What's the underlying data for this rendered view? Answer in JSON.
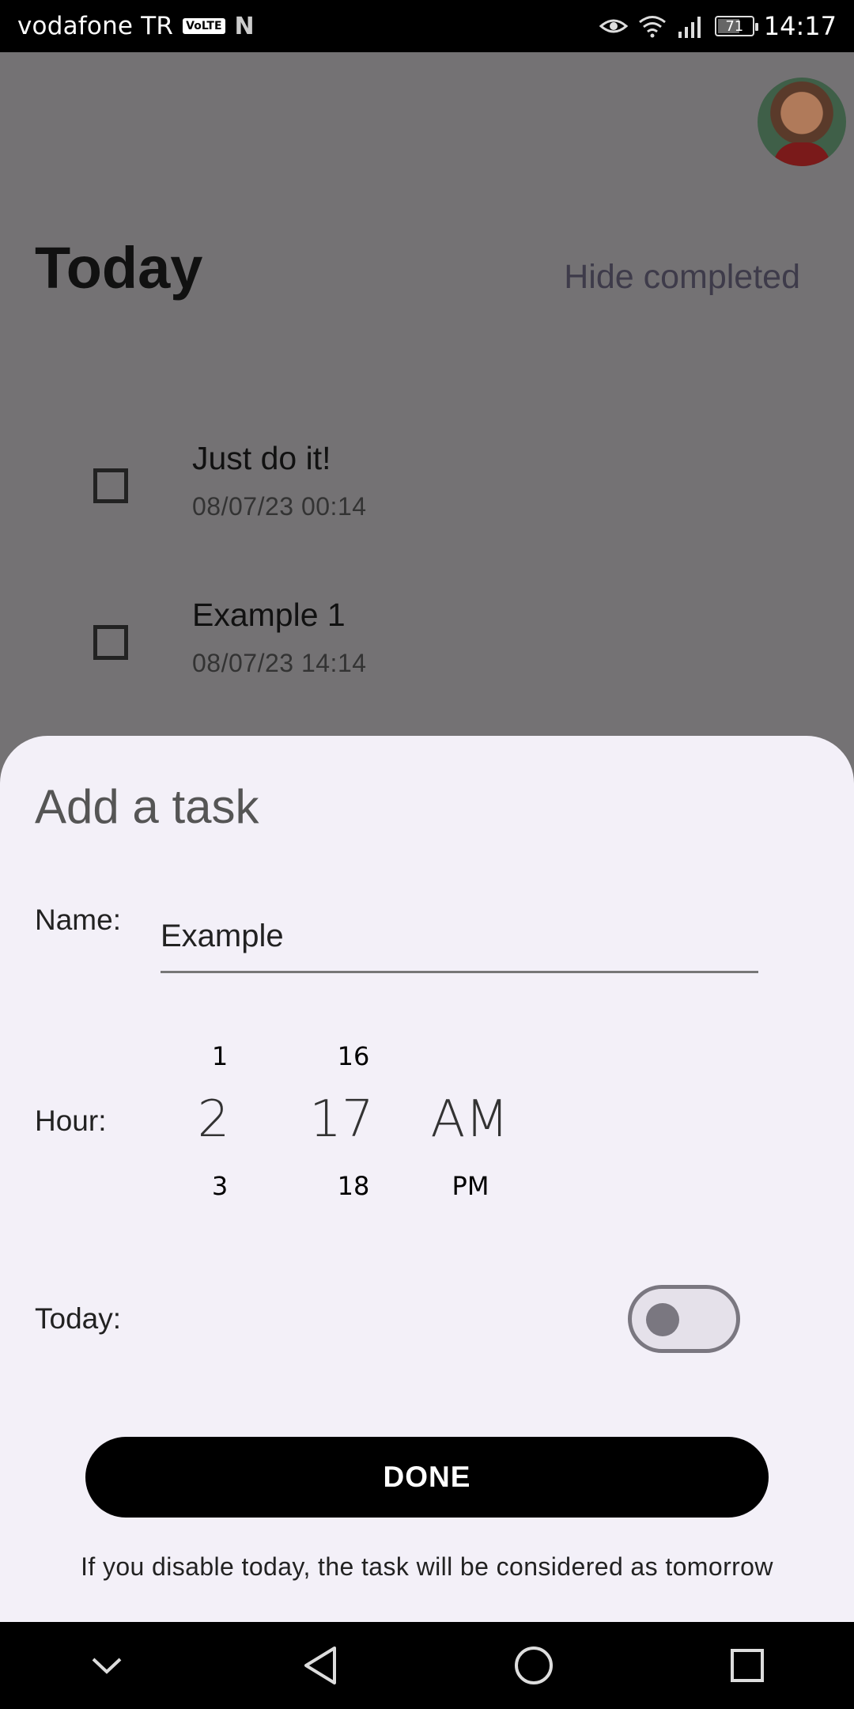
{
  "status_bar": {
    "carrier": "vodafone TR",
    "volte": "VoLTE",
    "n_icon": "N",
    "battery_level": "71",
    "time": "14:17",
    "icons": [
      "eye-icon",
      "wifi-icon",
      "signal-icon",
      "battery-icon"
    ]
  },
  "page": {
    "title": "Today",
    "hide_completed_label": "Hide completed",
    "tasks": [
      {
        "name": "Just do it!",
        "date": "08/07/23 00:14"
      },
      {
        "name": "Example 1",
        "date": "08/07/23 14:14"
      }
    ]
  },
  "sheet": {
    "title": "Add a task",
    "name_label": "Name:",
    "name_value": "Example",
    "hour_label": "Hour:",
    "hour_picker": {
      "hour_prev": "1",
      "hour_selected": "2",
      "hour_next": "3",
      "minute_prev": "16",
      "minute_selected": "17",
      "minute_next": "18",
      "period_selected": "AM",
      "period_next": "PM"
    },
    "today_label": "Today:",
    "today_toggle_on": false,
    "done_label": "DONE",
    "hint": "If you disable today, the task will be considered as tomorrow"
  },
  "nav_bar": {
    "icons": [
      "chevron-down-icon",
      "back-icon",
      "home-icon",
      "recents-icon"
    ]
  }
}
